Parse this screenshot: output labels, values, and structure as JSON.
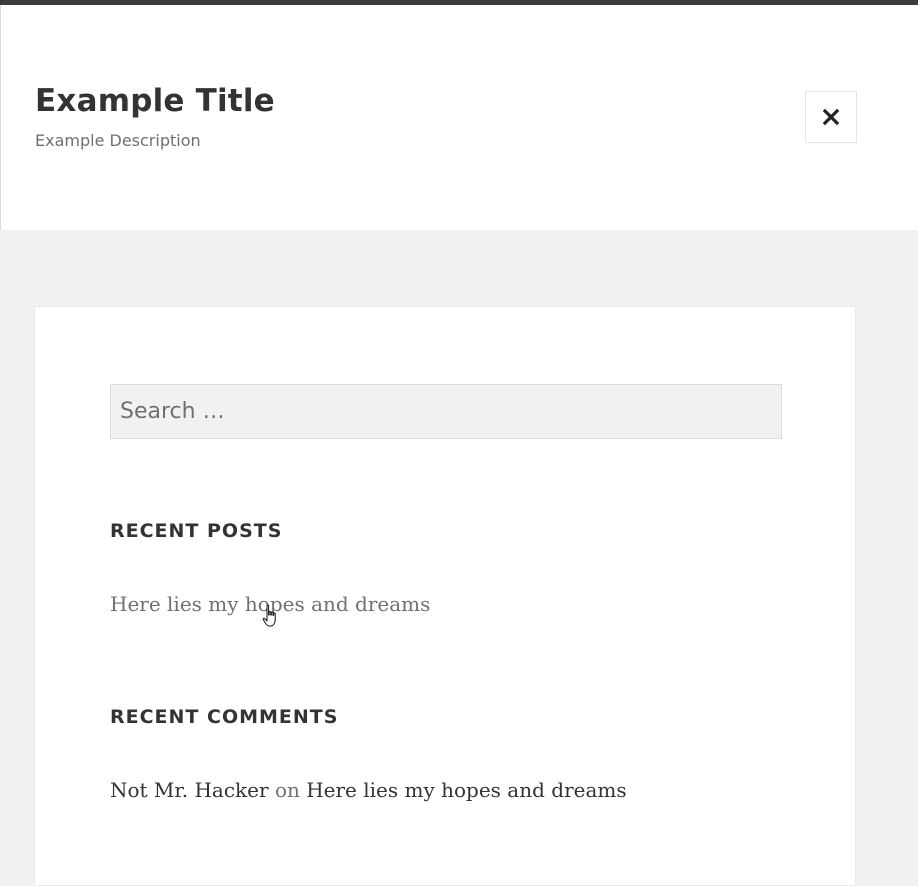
{
  "header": {
    "site_title": "Example Title",
    "site_description": "Example Description",
    "close_icon": "close-icon"
  },
  "search": {
    "placeholder": "Search …"
  },
  "recent_posts": {
    "title": "RECENT POSTS",
    "items": [
      {
        "label": "Here lies my hopes and dreams"
      }
    ]
  },
  "recent_comments": {
    "title": "RECENT COMMENTS",
    "items": [
      {
        "author": "Not Mr. Hacker",
        "separator": "on",
        "post": "Here lies my hopes and dreams"
      }
    ]
  },
  "colors": {
    "header_background": "#ffffff",
    "page_background": "#f1f1f1",
    "top_bar": "#3c3c3c",
    "title_text": "#333333",
    "muted_text": "#707070"
  }
}
